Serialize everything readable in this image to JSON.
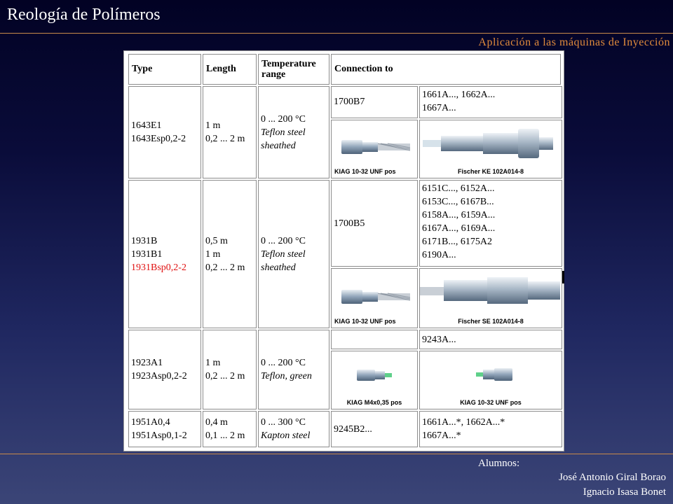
{
  "header": {
    "title": "Reología de Polímeros",
    "subtitle": "Aplicación a las máquinas de  Inyección"
  },
  "table": {
    "headers": {
      "type": "Type",
      "length": "Length",
      "temp_line1": "Temperature",
      "temp_line2": "range",
      "connection": "Connection to"
    },
    "row1": {
      "type": [
        "1643E1",
        "1643Esp0,2-2"
      ],
      "length": [
        "1 m",
        "0,2 ... 2 m"
      ],
      "temp": [
        "0 ... 200 °C",
        "Teflon steel",
        "sheathed"
      ],
      "conn_a": "1700B7",
      "conn_b": [
        "1661A..., 1662A...",
        "1667A..."
      ],
      "photo_a_caption": "KIAG 10-32 UNF pos",
      "photo_b_caption": "Fischer KE 102A014-8"
    },
    "row2": {
      "type": [
        "1931B",
        "1931B1",
        "1931Bsp0,2-2"
      ],
      "length": [
        "0,5 m",
        "1 m",
        "0,2 ... 2 m"
      ],
      "temp": [
        "0 ... 200 °C",
        "Teflon steel",
        "sheathed"
      ],
      "conn_a": "1700B5",
      "conn_b": [
        "6151C..., 6152A...",
        "6153C..., 6167B...",
        "6158A..., 6159A...",
        "6167A..., 6169A...",
        "6171B..., 6175A2",
        "6190A..."
      ],
      "photo_a_caption": "KIAG 10-32 UNF pos",
      "photo_b_caption": "Fischer SE 102A014-8"
    },
    "row3": {
      "type": [
        "1923A1",
        "1923Asp0,2-2"
      ],
      "length": [
        "1 m",
        "0,2 ... 2 m"
      ],
      "temp": [
        "0 ... 200 °C",
        "Teflon, green"
      ],
      "conn_b": "9243A...",
      "photo_a_caption": "KIAG M4x0,35 pos",
      "photo_b_caption": "KIAG 10-32 UNF pos"
    },
    "row4": {
      "type": [
        "1951A0,4",
        "1951Asp0,1-2"
      ],
      "length": [
        "0,4 m",
        "0,1 ... 2 m"
      ],
      "temp": [
        "0 ... 300 °C",
        "Kapton steel"
      ],
      "conn_a": "9245B2...",
      "conn_b": [
        "1661A...*, 1662A...*",
        "1667A...*"
      ]
    }
  },
  "footer": {
    "label": "Alumnos:",
    "name1": "José Antonio Giral Borao",
    "name2": "Ignacio Isasa Bonet"
  },
  "colors": {
    "accent": "#e08a3c",
    "rule": "#c98a4a",
    "highlight": "#e01010"
  }
}
